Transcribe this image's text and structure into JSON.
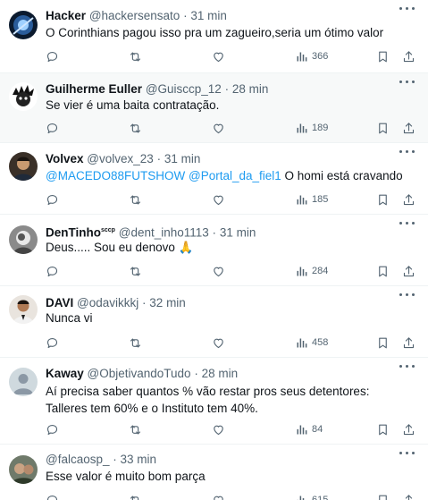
{
  "tweets": [
    {
      "name": "Hacker",
      "badge": "",
      "handle": "@hackersensato",
      "dot": "·",
      "time": "31 min",
      "text": "O Corinthians pagou isso pra um zagueiro,seria um ótimo valor",
      "views": "366"
    },
    {
      "name": "Guilherme Euller",
      "badge": "",
      "handle": "@Guisccp_12",
      "dot": "·",
      "time": "28 min",
      "text": "Se vier é uma baita contratação.",
      "views": "189"
    },
    {
      "name": "Volvex",
      "badge": "",
      "handle": "@volvex_23",
      "dot": "·",
      "time": "31 min",
      "mention1": "@MACEDO88FUTSHOW",
      "mention2": "@Portal_da_fiel1",
      "text": "O homi está cravando",
      "views": "185"
    },
    {
      "name": "DenTinho",
      "badge": "sccp",
      "handle": "@dent_inho1113",
      "dot": "·",
      "time": "31 min",
      "text": "Deus..... Sou eu denovo",
      "emoji": "🙏",
      "views": "284"
    },
    {
      "name": "DAVI",
      "badge": "",
      "handle": "@odavikkkj",
      "dot": "·",
      "time": "32 min",
      "text": "Nunca vi",
      "views": "458"
    },
    {
      "name": "Kaway",
      "badge": "",
      "handle": "@ObjetivandoTudo",
      "dot": "·",
      "time": "28 min",
      "text": "Aí precisa saber quantos % vão restar pros seus detentores: Talleres tem 60% e o Instituto tem 40%.",
      "views": "84"
    },
    {
      "name": "",
      "badge": "",
      "handle": "@falcaosp_",
      "dot": "·",
      "time": "33 min",
      "text": "Esse valor é muito bom parça",
      "views": "615"
    }
  ],
  "icons": {
    "reply": "reply-icon",
    "retweet": "retweet-icon",
    "like": "heart-icon",
    "views": "views-icon",
    "bookmark": "bookmark-icon",
    "share": "share-icon",
    "more": "more-icon"
  },
  "colors": {
    "link": "#1d9bf0",
    "secondary": "#536471",
    "highlight_bg": "#f7f9f9"
  }
}
